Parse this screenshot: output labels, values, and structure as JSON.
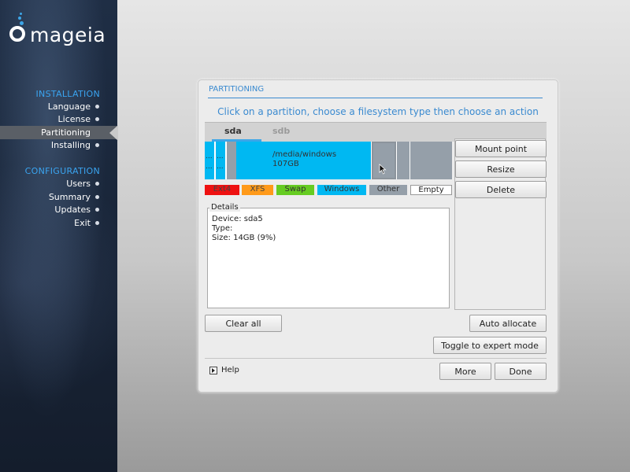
{
  "brand": {
    "name": "mageia",
    "accent": "#3da6e8"
  },
  "sidebar": {
    "installation_title": "INSTALLATION",
    "configuration_title": "CONFIGURATION",
    "installation_items": [
      {
        "label": "Language"
      },
      {
        "label": "License"
      },
      {
        "label": "Partitioning",
        "active": true
      },
      {
        "label": "Installing"
      }
    ],
    "configuration_items": [
      {
        "label": "Users"
      },
      {
        "label": "Summary"
      },
      {
        "label": "Updates"
      },
      {
        "label": "Exit"
      }
    ]
  },
  "dialog": {
    "title": "PARTITIONING",
    "instruction": "Click on a partition, choose a filesystem type then choose an action",
    "tabs": [
      {
        "label": "sda",
        "active": true
      },
      {
        "label": "sdb"
      }
    ],
    "partitions": {
      "dots": "...",
      "selected_mount": "/media/windows",
      "selected_size": "107GB"
    },
    "legend": [
      "Ext4",
      "XFS",
      "Swap",
      "Windows",
      "Other",
      "Empty"
    ],
    "legend_colors": {
      "ext4": "#ee1111",
      "xfs": "#ff9a1a",
      "swap": "#66cc22",
      "windows": "#00b8f2",
      "other": "#959fa9",
      "empty": "#ffffff"
    },
    "details": {
      "legend": "Details",
      "device": "Device: sda5",
      "type": "Type:",
      "size": "Size: 14GB (9%)"
    },
    "actions": {
      "mount_point": "Mount point",
      "resize": "Resize",
      "delete": "Delete",
      "clear_all": "Clear all",
      "auto_allocate": "Auto allocate",
      "toggle_expert": "Toggle to expert mode",
      "help": "Help",
      "more": "More",
      "done": "Done"
    }
  }
}
